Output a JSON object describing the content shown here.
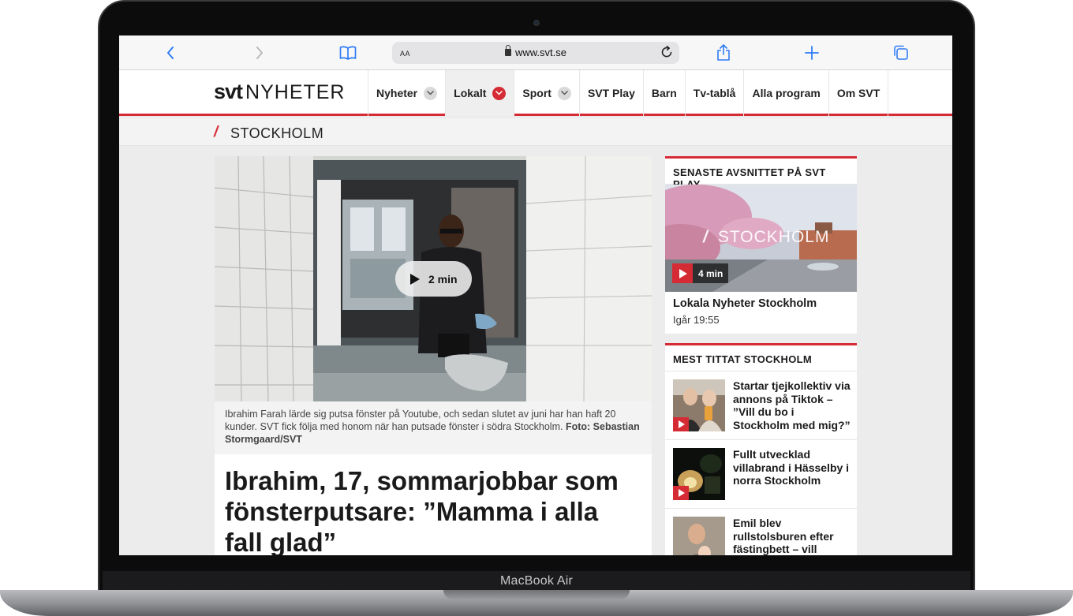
{
  "device": {
    "brand_label": "MacBook Air"
  },
  "browser": {
    "aa_label": "AA",
    "url": "www.svt.se"
  },
  "site": {
    "logo_bold": "svt",
    "logo_text": "NYHETER",
    "nav": [
      {
        "label": "Nyheter",
        "has_dropdown": true,
        "active": false
      },
      {
        "label": "Lokalt",
        "has_dropdown": true,
        "active": true
      },
      {
        "label": "Sport",
        "has_dropdown": true,
        "active": false
      },
      {
        "label": "SVT Play",
        "has_dropdown": false,
        "active": false
      },
      {
        "label": "Barn",
        "has_dropdown": false,
        "active": false
      },
      {
        "label": "Tv-tablå",
        "has_dropdown": false,
        "active": false
      },
      {
        "label": "Alla program",
        "has_dropdown": false,
        "active": false
      },
      {
        "label": "Om SVT",
        "has_dropdown": false,
        "active": false
      }
    ],
    "region_slash": "/",
    "region": "STOCKHOLM",
    "accent_color": "#d52b35"
  },
  "article": {
    "video_duration": "2 min",
    "caption_text": "Ibrahim Farah lärde sig putsa fönster på Youtube, och sedan slutet av juni har han haft 20 kunder. SVT fick följa med honom när han putsade fönster i södra Stockholm. ",
    "caption_credit": "Foto: Sebastian Stormgaard/SVT",
    "headline": "Ibrahim, 17, sommarjobbar som fönsterputsare: ”Mamma i alla fall glad”"
  },
  "sidebar": {
    "latest": {
      "title": "SENASTE AVSNITTET PÅ SVT PLAY",
      "thumb_slash": "/",
      "thumb_title": "STOCKHOLM",
      "duration": "4 min",
      "episode_title": "Lokala Nyheter Stockholm",
      "episode_time": "Igår 19:55"
    },
    "most_viewed": {
      "title": "MEST TITTAT STOCKHOLM",
      "items": [
        {
          "text": "Startar tjejkollektiv via annons på Tiktok – ”Vill du bo i Stockholm med mig?”"
        },
        {
          "text": "Fullt utvecklad villabrand i Hässelby i norra Stockholm"
        },
        {
          "text": "Emil blev rullstolsburen efter fästingbett – vill"
        }
      ]
    }
  }
}
